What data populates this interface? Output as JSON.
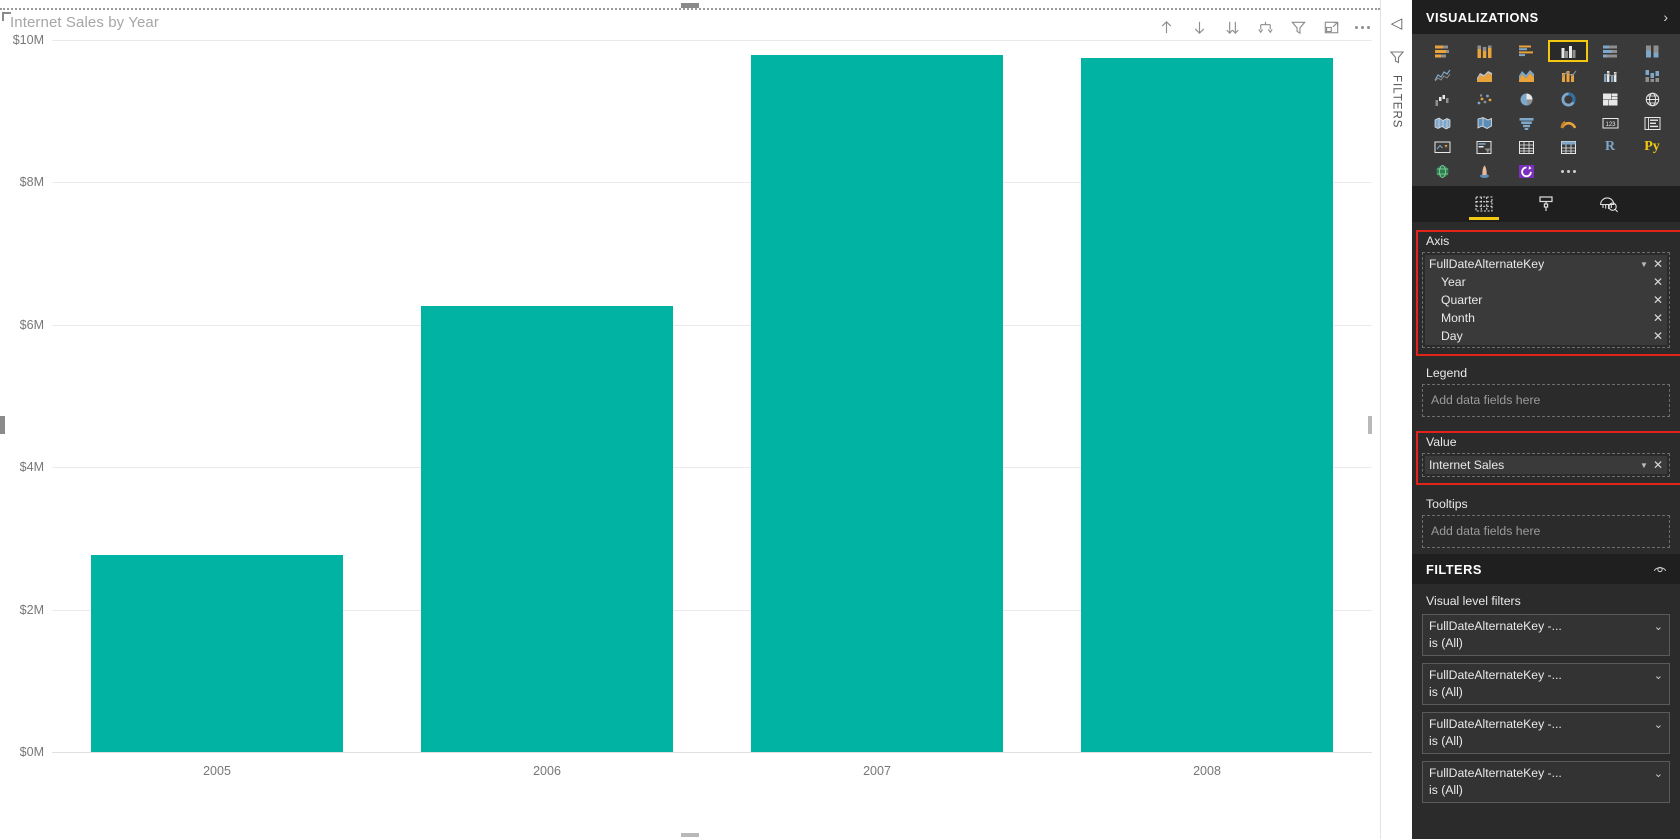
{
  "visual": {
    "title": "Internet Sales by Year",
    "toolbar": [
      {
        "name": "spotlight-up-icon",
        "label": "Up"
      },
      {
        "name": "drill-down-icon",
        "label": "Drill down"
      },
      {
        "name": "expand-all-down-icon",
        "label": "Expand all down one level"
      },
      {
        "name": "drill-up-hierarchy-icon",
        "label": "Go to next level"
      },
      {
        "name": "filter-icon",
        "label": "Filters"
      },
      {
        "name": "focus-mode-icon",
        "label": "Focus mode"
      },
      {
        "name": "more-options-icon",
        "label": "More options"
      }
    ]
  },
  "chart_data": {
    "type": "bar",
    "title": "Internet Sales by Year",
    "categories": [
      "2005",
      "2006",
      "2007",
      "2008"
    ],
    "values": [
      2770000,
      6260000,
      9790000,
      9750000
    ],
    "xlabel": "",
    "ylabel": "",
    "ylim": [
      0,
      10000000
    ],
    "ytick_labels": [
      "$0M",
      "$2M",
      "$4M",
      "$6M",
      "$8M",
      "$10M"
    ],
    "ytick_values": [
      0,
      2000000,
      4000000,
      6000000,
      8000000,
      10000000
    ],
    "series": [
      {
        "name": "Internet Sales",
        "values": [
          2770000,
          6260000,
          9790000,
          9750000
        ]
      }
    ],
    "bar_color": "#00B3A3",
    "grid": true,
    "legend": "none"
  },
  "filters_rail": {
    "collapse_label": "◁",
    "icon": "filter-icon",
    "label": "FILTERS"
  },
  "pane": {
    "title": "VISUALIZATIONS",
    "chevron": "›",
    "viz_icons": [
      {
        "name": "stacked-bar-chart-icon",
        "selected": false
      },
      {
        "name": "stacked-column-chart-icon",
        "selected": false
      },
      {
        "name": "clustered-bar-chart-icon",
        "selected": false
      },
      {
        "name": "clustered-column-chart-icon",
        "selected": true
      },
      {
        "name": "100-percent-stacked-bar-chart-icon",
        "selected": false
      },
      {
        "name": "100-percent-stacked-column-chart-icon",
        "selected": false
      },
      {
        "name": "line-chart-icon",
        "selected": false
      },
      {
        "name": "area-chart-icon",
        "selected": false
      },
      {
        "name": "stacked-area-chart-icon",
        "selected": false
      },
      {
        "name": "line-and-stacked-column-chart-icon",
        "selected": false
      },
      {
        "name": "line-and-clustered-column-chart-icon",
        "selected": false
      },
      {
        "name": "ribbon-chart-icon",
        "selected": false
      },
      {
        "name": "waterfall-chart-icon",
        "selected": false
      },
      {
        "name": "scatter-chart-icon",
        "selected": false
      },
      {
        "name": "pie-chart-icon",
        "selected": false
      },
      {
        "name": "donut-chart-icon",
        "selected": false
      },
      {
        "name": "treemap-icon",
        "selected": false
      },
      {
        "name": "map-icon",
        "selected": false
      },
      {
        "name": "filled-map-icon",
        "selected": false
      },
      {
        "name": "shape-map-icon",
        "selected": false
      },
      {
        "name": "funnel-chart-icon",
        "selected": false
      },
      {
        "name": "gauge-chart-icon",
        "selected": false
      },
      {
        "name": "card-icon",
        "selected": false
      },
      {
        "name": "multi-row-card-icon",
        "selected": false
      },
      {
        "name": "kpi-icon",
        "selected": false
      },
      {
        "name": "slicer-icon",
        "selected": false
      },
      {
        "name": "table-icon",
        "selected": false
      },
      {
        "name": "matrix-icon",
        "selected": false
      },
      {
        "name": "r-script-visual-icon",
        "selected": false
      },
      {
        "name": "python-visual-icon",
        "selected": false
      },
      {
        "name": "arcgis-maps-icon",
        "selected": false
      },
      {
        "name": "power-apps-visual-icon",
        "selected": false
      },
      {
        "name": "power-automate-visual-icon",
        "selected": false
      },
      {
        "name": "get-more-visuals-icon",
        "selected": false
      }
    ],
    "well_tabs": [
      {
        "name": "tab-fields",
        "active": true
      },
      {
        "name": "tab-format",
        "active": false
      },
      {
        "name": "tab-analytics",
        "active": false
      }
    ],
    "wells": {
      "axis": {
        "title": "Axis",
        "fields": [
          {
            "label": "FullDateAlternateKey",
            "indent": false
          },
          {
            "label": "Year",
            "indent": true
          },
          {
            "label": "Quarter",
            "indent": true
          },
          {
            "label": "Month",
            "indent": true
          },
          {
            "label": "Day",
            "indent": true
          }
        ]
      },
      "legend": {
        "title": "Legend",
        "placeholder": "Add data fields here"
      },
      "value": {
        "title": "Value",
        "fields": [
          {
            "label": "Internet Sales",
            "indent": false
          }
        ]
      },
      "tooltips": {
        "title": "Tooltips",
        "placeholder": "Add data fields here"
      }
    }
  },
  "filters": {
    "title": "FILTERS",
    "eye_icon": "hide-filters-icon",
    "subtitle": "Visual level filters",
    "cards": [
      {
        "name": "FullDateAlternateKey -...",
        "state": "is (All)"
      },
      {
        "name": "FullDateAlternateKey -...",
        "state": "is (All)"
      },
      {
        "name": "FullDateAlternateKey -...",
        "state": "is (All)"
      },
      {
        "name": "FullDateAlternateKey -...",
        "state": "is (All)"
      }
    ]
  },
  "highlight_color": "#e2231a"
}
